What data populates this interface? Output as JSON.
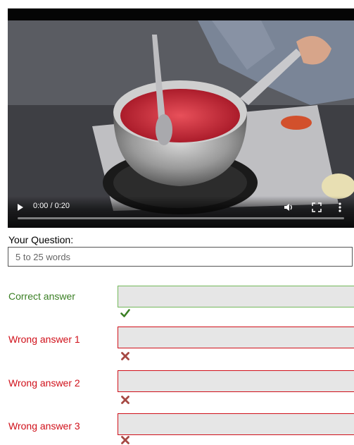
{
  "video": {
    "time": "0:00 / 0:20",
    "progress": 0
  },
  "question": {
    "label": "Your Question:",
    "placeholder": "5 to 25 words"
  },
  "answers": [
    {
      "label": "Correct answer",
      "type": "correct",
      "icon": "check-icon"
    },
    {
      "label": "Wrong answer 1",
      "type": "wrong",
      "icon": "cross-icon"
    },
    {
      "label": "Wrong answer 2",
      "type": "wrong",
      "icon": "cross-icon"
    },
    {
      "label": "Wrong answer 3",
      "type": "wrong",
      "icon": "cross-icon"
    }
  ],
  "colors": {
    "correct": "#3a7f24",
    "wrong": "#d0101a",
    "wrong_mark": "#a64843"
  }
}
